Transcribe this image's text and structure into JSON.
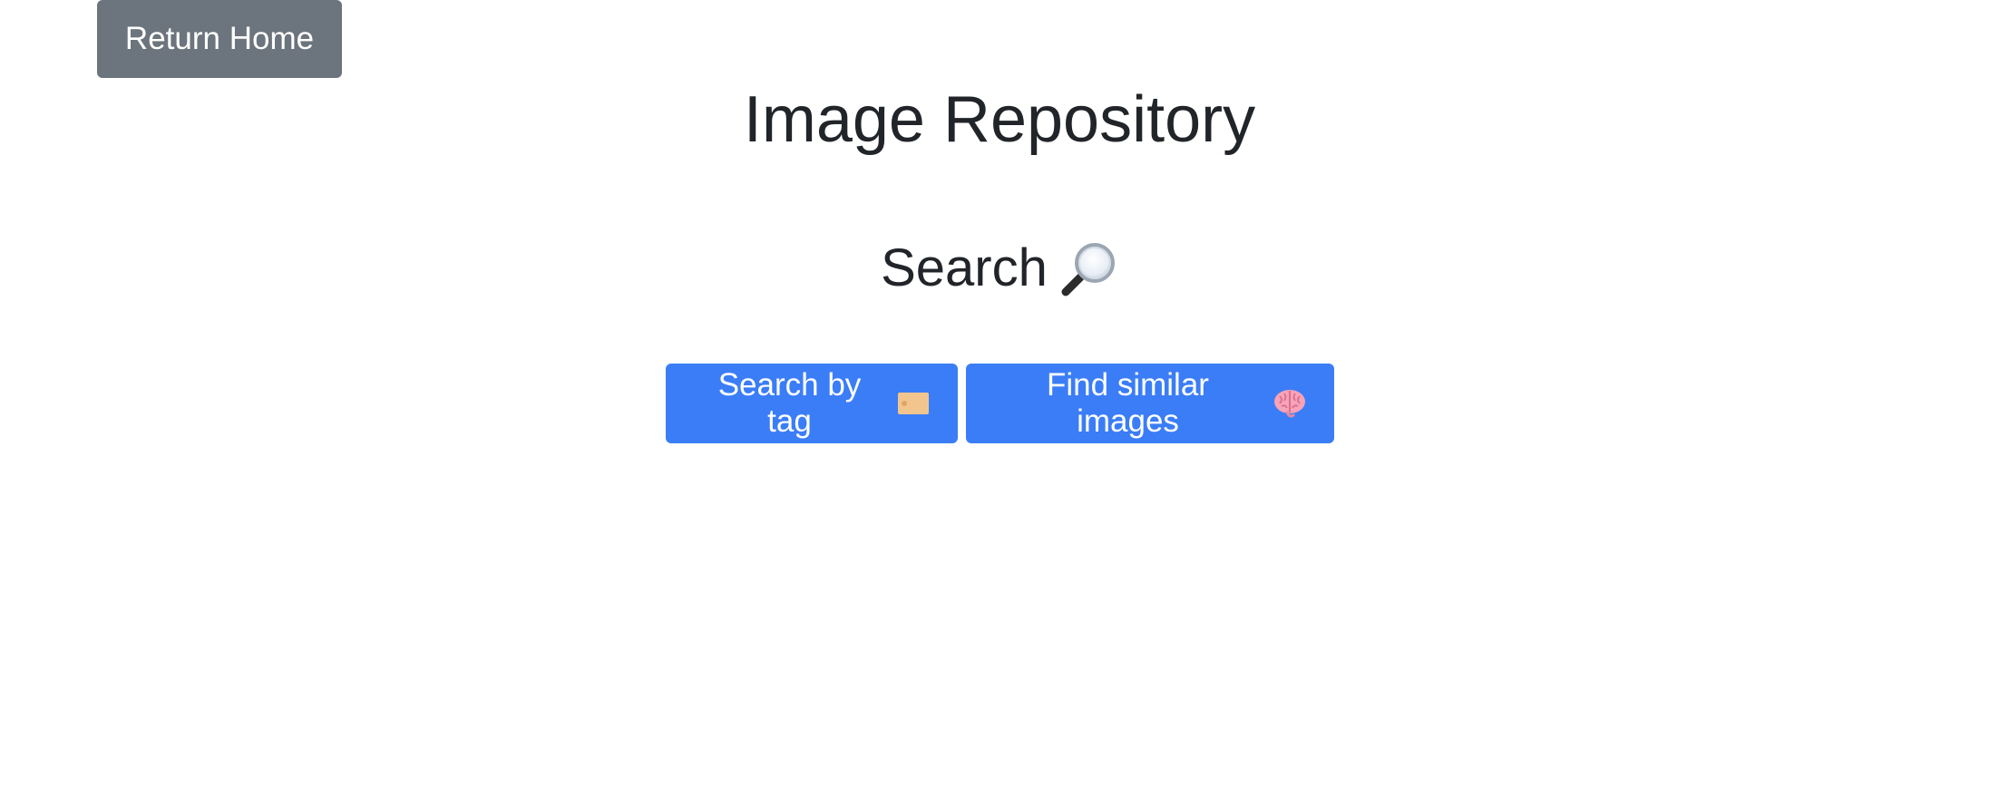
{
  "header": {
    "return_home_label": "Return Home"
  },
  "main": {
    "title": "Image Repository",
    "search_heading": "Search",
    "search_icon": "magnifying-glass-icon",
    "actions": [
      {
        "label": "Search by tag",
        "icon": "label-tag-icon"
      },
      {
        "label": "Find similar images",
        "icon": "brain-icon"
      }
    ]
  },
  "colors": {
    "secondary": "#6c757d",
    "primary": "#3b7df6",
    "text": "#212529"
  }
}
